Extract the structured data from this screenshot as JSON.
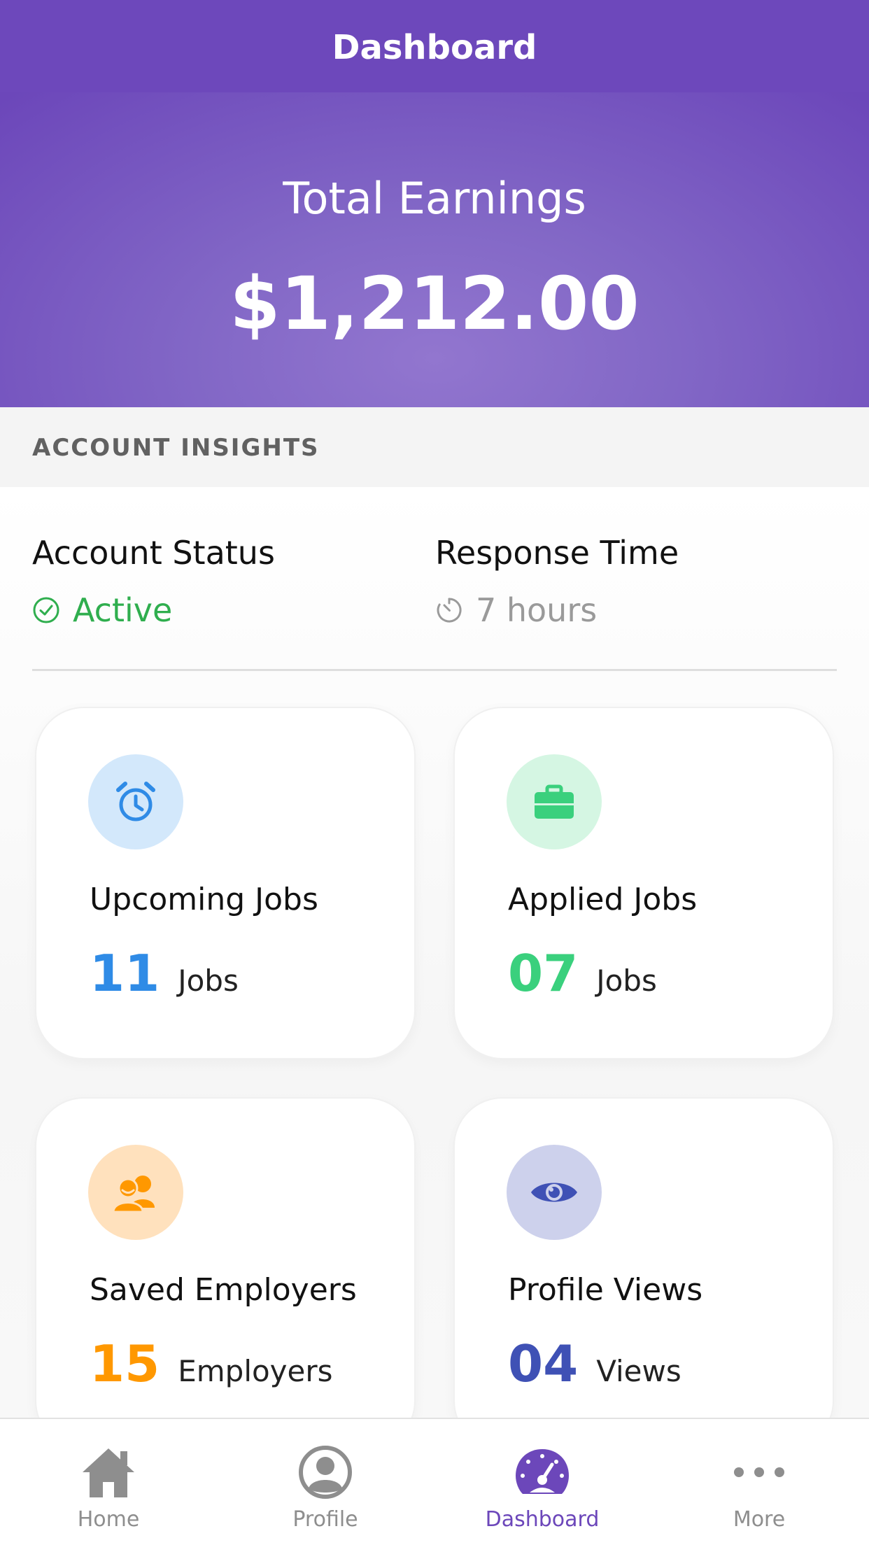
{
  "nav": {
    "title": "Dashboard"
  },
  "earnings": {
    "label": "Total Earnings",
    "amount": "$1,212.00"
  },
  "insights": {
    "section_title": "ACCOUNT INSIGHTS",
    "account_status": {
      "label": "Account Status",
      "value": "Active",
      "icon": "check-circle-icon",
      "color": "#2fae4e"
    },
    "response_time": {
      "label": "Response Time",
      "value": "7 hours",
      "icon": "timer-icon",
      "color": "#9a9a9a"
    }
  },
  "cards": [
    {
      "title": "Upcoming Jobs",
      "count": "11",
      "unit": "Jobs",
      "icon": "alarm-clock-icon",
      "color": "#2f8be6",
      "icon_bg": "#d3e8fb"
    },
    {
      "title": "Applied Jobs",
      "count": "07",
      "unit": "Jobs",
      "icon": "briefcase-icon",
      "color": "#3ad07d",
      "icon_bg": "#d5f6e3"
    },
    {
      "title": "Saved Employers",
      "count": "15",
      "unit": "Employers",
      "icon": "users-icon",
      "color": "#ff9800",
      "icon_bg": "#ffe1bd"
    },
    {
      "title": "Profile Views",
      "count": "04",
      "unit": "Views",
      "icon": "eye-icon",
      "color": "#3f51b5",
      "icon_bg": "#cdd1ec"
    }
  ],
  "tabs": [
    {
      "label": "Home",
      "icon": "home-icon",
      "active": false
    },
    {
      "label": "Profile",
      "icon": "profile-icon",
      "active": false
    },
    {
      "label": "Dashboard",
      "icon": "speedometer-icon",
      "active": true
    },
    {
      "label": "More",
      "icon": "more-dots-icon",
      "active": false
    }
  ],
  "colors": {
    "brand": "#6c47ba",
    "tab_inactive": "#8e8e8e"
  }
}
